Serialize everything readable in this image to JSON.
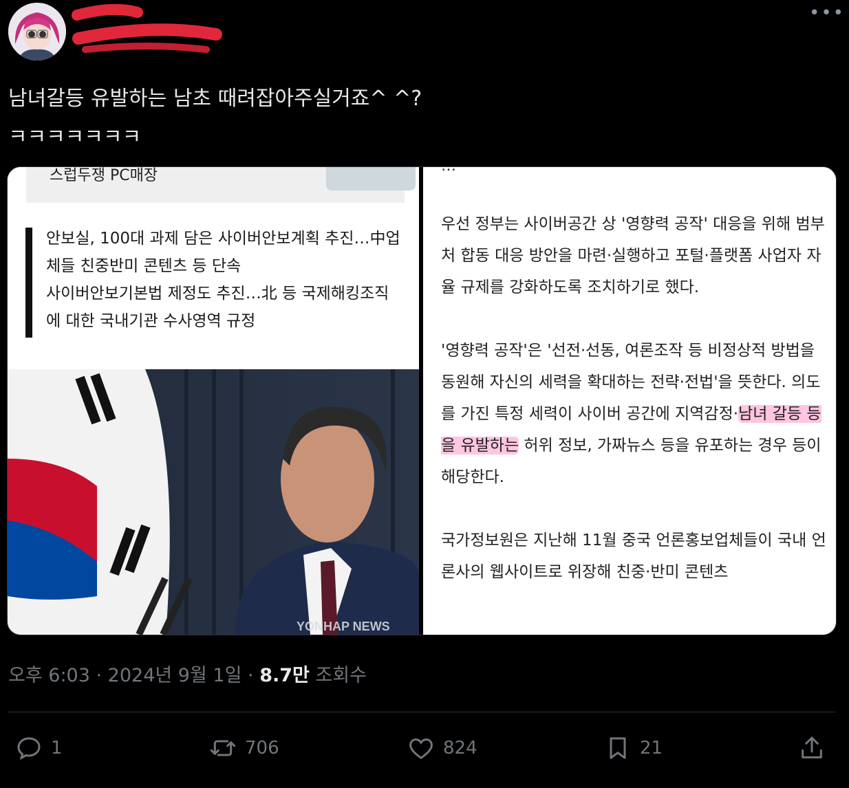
{
  "tweet": {
    "text": "남녀갈등 유발하는 남초 때려잡아주실거죠^ ^?\nㅋㅋㅋㅋㅋㅋㅋ",
    "time": "오후 6:03",
    "date": "2024년 9월 1일",
    "views_count": "8.7만",
    "views_label": "조회수",
    "more_icon": "more-icon"
  },
  "media": {
    "left": {
      "top_cut_text": "스럽두쟁 PC매장",
      "quote": "안보실, 100대 과제 담은 사이버안보계획 추진…中업\n체들 친중반미 콘텐츠 등 단속\n사이버안보기본법 제정도 추진…北 등 국제해킹조직\n에 대한 국내기관 수사영역 규정",
      "watermark": "YONHAP NEWS"
    },
    "right": {
      "top_cut_text": "…",
      "para1": "우선 정부는 사이버공간 상 '영향력 공작' 대응을 위해 범부처 합동 대응 방안을 마련·실행하고 포털·플랫폼 사업자 자율 규제를 강화하도록 조치하기로 했다.",
      "para2_before": "'영향력 공작'은 '선전·선동, 여론조작 등 비정상적 방법을 동원해 자신의 세력을 확대하는 전략·전법'을 뜻한다. 의도를 가진 특정 세력이 사이버 공간에 지역감정·",
      "para2_highlight": "남녀 갈등 등을 유발하는",
      "para2_after": " 허위 정보, 가짜뉴스 등을 유포하는 경우 등이 해당한다.",
      "para3": "국가정보원은 지난해 11월 중국 언론홍보업체들이 국내 언론사의 웹사이트로 위장해 친중·반미 콘텐츠"
    }
  },
  "actions": {
    "reply": {
      "icon": "reply-icon",
      "count": "1"
    },
    "retweet": {
      "icon": "retweet-icon",
      "count": "706"
    },
    "like": {
      "icon": "heart-icon",
      "count": "824"
    },
    "bookmark": {
      "icon": "bookmark-icon",
      "count": "21"
    },
    "share": {
      "icon": "share-icon"
    }
  },
  "colors": {
    "background": "#000000",
    "text": "#e7e9ea",
    "muted": "#71767b",
    "highlight": "#ff96c8"
  }
}
